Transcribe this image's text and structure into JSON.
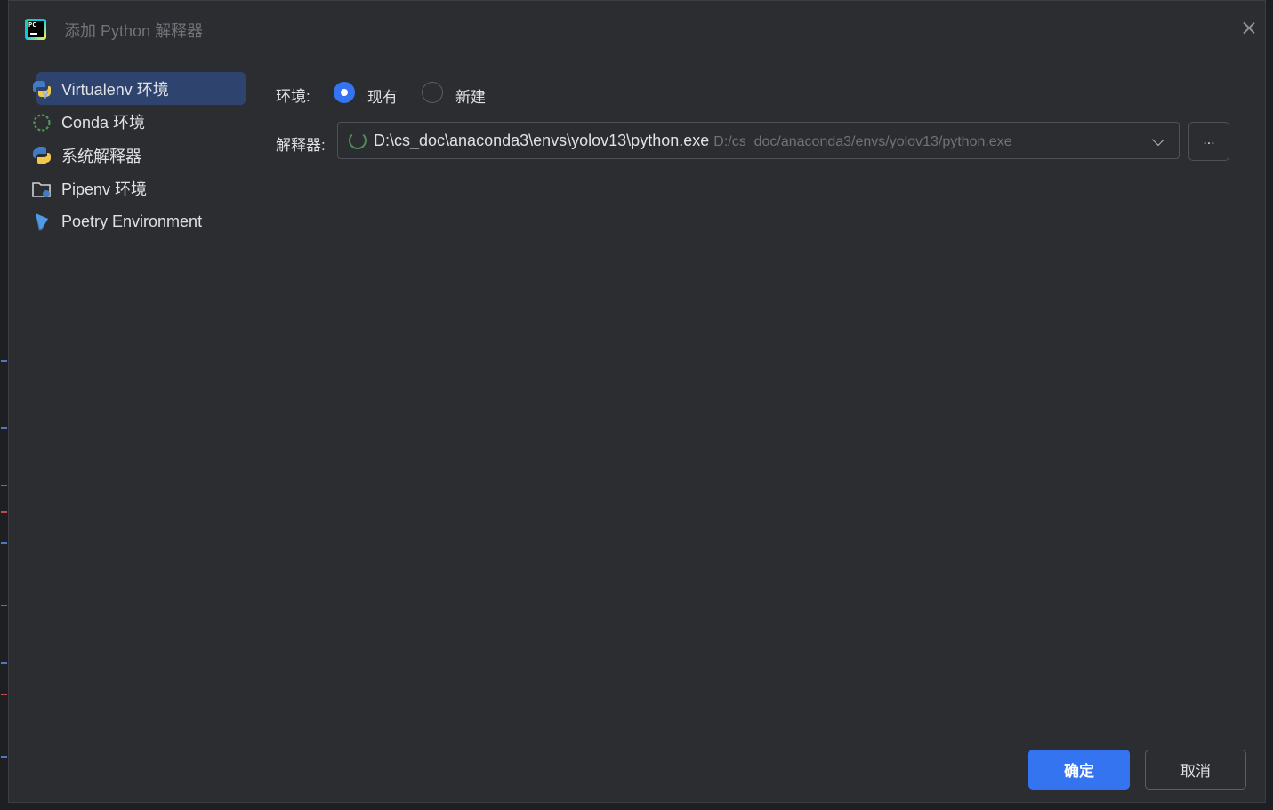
{
  "window": {
    "title": "添加 Python 解释器"
  },
  "sidebar": {
    "items": [
      {
        "label": "Virtualenv 环境",
        "icon": "virtualenv-icon",
        "selected": true
      },
      {
        "label": "Conda 环境",
        "icon": "conda-icon",
        "selected": false
      },
      {
        "label": "系统解释器",
        "icon": "python-icon",
        "selected": false
      },
      {
        "label": "Pipenv 环境",
        "icon": "pipenv-folder-icon",
        "selected": false
      },
      {
        "label": "Poetry Environment",
        "icon": "poetry-icon",
        "selected": false
      }
    ]
  },
  "form": {
    "env_label": "环境:",
    "env_options": [
      {
        "label": "现有",
        "checked": true
      },
      {
        "label": "新建",
        "checked": false
      }
    ],
    "interpreter_label": "解释器:",
    "interpreter_value": "D:\\cs_doc\\anaconda3\\envs\\yolov13\\python.exe",
    "interpreter_path_hint": "D:/cs_doc/anaconda3/envs/yolov13/python.exe",
    "browse_label": "..."
  },
  "buttons": {
    "ok": "确定",
    "cancel": "取消"
  },
  "colors": {
    "accent": "#3574f0",
    "selected_bg": "#2e436e",
    "dialog_bg": "#2b2d30"
  }
}
